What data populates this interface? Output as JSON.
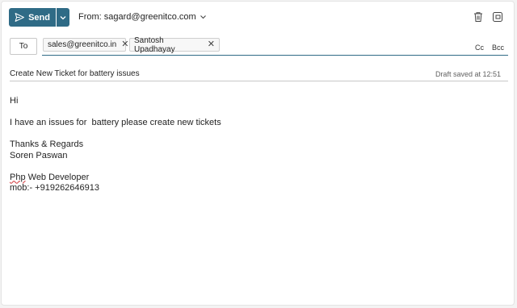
{
  "toolbar": {
    "send_label": "Send",
    "from_label": "From: sagard@greenitco.com",
    "icons": [
      "send-icon",
      "chevron-down-icon",
      "trash-icon",
      "pop-out-icon"
    ]
  },
  "recipients": {
    "to_label": "To",
    "chips": [
      "sales@greenitco.in",
      "Santosh Upadhayay"
    ],
    "cc_label": "Cc",
    "bcc_label": "Bcc"
  },
  "subject": {
    "text": "Create New Ticket for battery issues",
    "draft_status": "Draft saved at 12:51"
  },
  "body": {
    "greeting": "Hi",
    "message": "I have an issues for  battery please create new tickets",
    "closing": "Thanks & Regards",
    "name": "Soren Paswan",
    "title_word": "Php",
    "title_rest": " Web Developer",
    "phone": "mob:- +919262646913"
  },
  "colors": {
    "accent": "#2f6b86",
    "spellcheck": "#d13438"
  }
}
